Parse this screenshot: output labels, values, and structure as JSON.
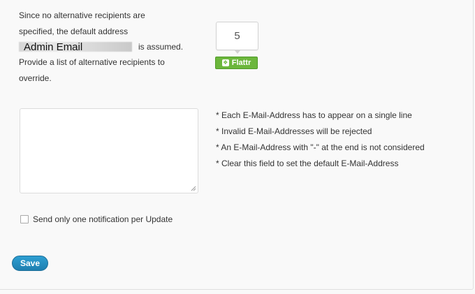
{
  "intro": {
    "line1": "Since no alternative recipients are",
    "line2": "specified, the default address",
    "redacted_label": "Admin Email",
    "line3_suffix": "is assumed.",
    "line4": "Provide a list of alternative recipients to",
    "line5": "override."
  },
  "flattr": {
    "count": "5",
    "button_label": "Flattr",
    "icon": "flattr-icon"
  },
  "recipients_field": {
    "value": ""
  },
  "hints": [
    "* Each E-Mail-Address has to appear on a single line",
    "* Invalid E-Mail-Addresses will be rejected",
    "* An E-Mail-Address with \"-\" at the end is not considered",
    "* Clear this field to set the default E-Mail-Address"
  ],
  "option": {
    "label": "Send only one notification per Update",
    "checked": false
  },
  "save_label": "Save",
  "colors": {
    "save_button": "#2184b9",
    "flattr_green": "#6cb73c"
  }
}
